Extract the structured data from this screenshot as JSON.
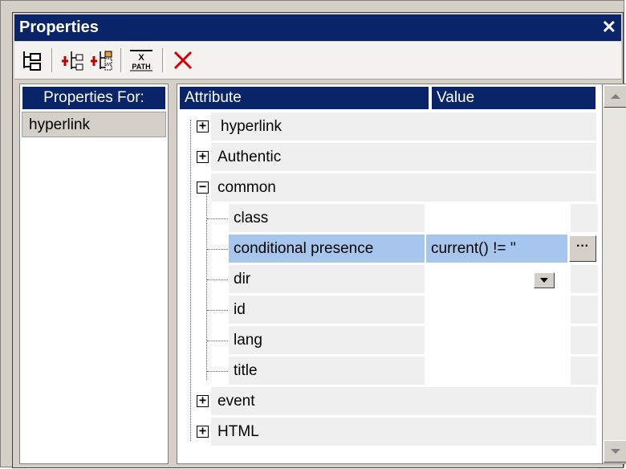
{
  "window": {
    "title": "Properties",
    "close_label": "✕"
  },
  "toolbar": {
    "buttons": [
      "tree-view-icon",
      "add-before-icon",
      "add-after-icon",
      "xpath-icon",
      "delete-icon"
    ],
    "xpath_label_top": "X",
    "xpath_label_bottom": "PATH"
  },
  "left_pane": {
    "header": "Properties For:",
    "selected": "hyperlink"
  },
  "grid": {
    "columns": [
      "Attribute",
      "Value"
    ],
    "rows": [
      {
        "label": "hyperlink",
        "expander": "+",
        "value": ""
      },
      {
        "label": "Authentic",
        "expander": "+",
        "value": ""
      },
      {
        "label": "common",
        "expander": "−",
        "value": ""
      },
      {
        "label": "class",
        "expander": "",
        "value": ""
      },
      {
        "label": "conditional presence",
        "expander": "",
        "value": "current() != ''"
      },
      {
        "label": "dir",
        "expander": "",
        "value": ""
      },
      {
        "label": "id",
        "expander": "",
        "value": ""
      },
      {
        "label": "lang",
        "expander": "",
        "value": ""
      },
      {
        "label": "title",
        "expander": "",
        "value": ""
      },
      {
        "label": "event",
        "expander": "+",
        "value": ""
      },
      {
        "label": "HTML",
        "expander": "+",
        "value": ""
      }
    ],
    "edit_button_label": "···"
  },
  "colors": {
    "title_bar": "#0a246a",
    "selected_row": "#a7c6ee",
    "row_bg": "#efefef"
  }
}
